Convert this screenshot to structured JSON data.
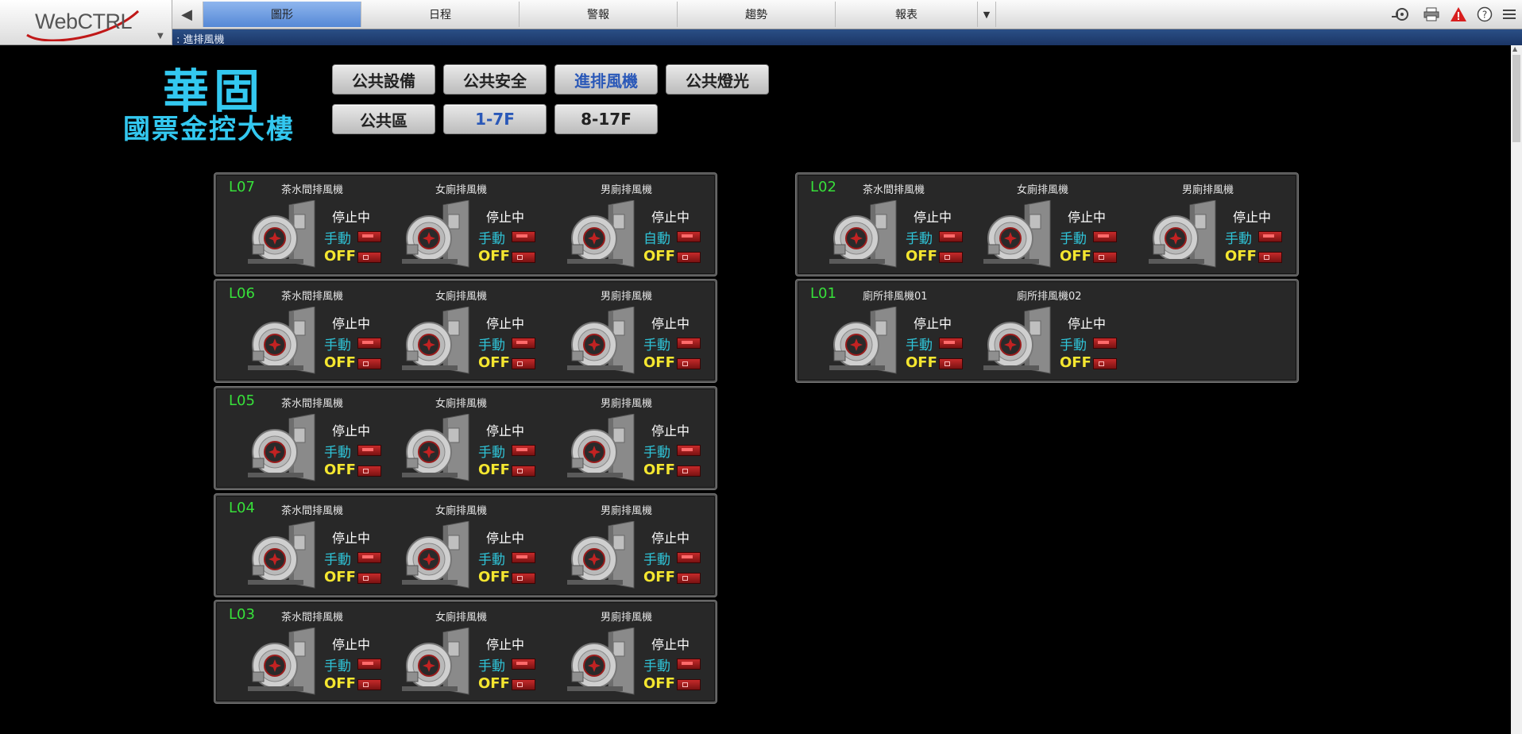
{
  "app": {
    "logo": "WebCTRL"
  },
  "nav": {
    "tabs": [
      {
        "label": "圖形",
        "active": true
      },
      {
        "label": "日程",
        "active": false
      },
      {
        "label": "警報",
        "active": false
      },
      {
        "label": "趨勢",
        "active": false
      },
      {
        "label": "報表",
        "active": false
      }
    ],
    "tools": [
      "network-icon",
      "print-icon",
      "alarm-warning-icon",
      "help-icon",
      "menu-icon"
    ]
  },
  "breadcrumb": ": 進排風機",
  "building": {
    "line1": "華固",
    "line2": "國票金控大樓"
  },
  "categories": {
    "row1": [
      {
        "label": "公共設備",
        "selected": false
      },
      {
        "label": "公共安全",
        "selected": false
      },
      {
        "label": "進排風機",
        "selected": true
      },
      {
        "label": "公共燈光",
        "selected": false
      }
    ],
    "row2": [
      {
        "label": "公共區",
        "selected": false
      },
      {
        "label": "1-7F",
        "selected": true
      },
      {
        "label": "8-17F",
        "selected": false
      }
    ]
  },
  "panels": {
    "L07": {
      "floor": "L07",
      "units": [
        {
          "name": "茶水間排風機",
          "run": "停止中",
          "mode": "手動",
          "onoff": "OFF"
        },
        {
          "name": "女廁排風機",
          "run": "停止中",
          "mode": "手動",
          "onoff": "OFF"
        },
        {
          "name": "男廁排風機",
          "run": "停止中",
          "mode": "自動",
          "onoff": "OFF"
        }
      ]
    },
    "L06": {
      "floor": "L06",
      "units": [
        {
          "name": "茶水間排風機",
          "run": "停止中",
          "mode": "手動",
          "onoff": "OFF"
        },
        {
          "name": "女廁排風機",
          "run": "停止中",
          "mode": "手動",
          "onoff": "OFF"
        },
        {
          "name": "男廁排風機",
          "run": "停止中",
          "mode": "手動",
          "onoff": "OFF"
        }
      ]
    },
    "L05": {
      "floor": "L05",
      "units": [
        {
          "name": "茶水間排風機",
          "run": "停止中",
          "mode": "手動",
          "onoff": "OFF"
        },
        {
          "name": "女廁排風機",
          "run": "停止中",
          "mode": "手動",
          "onoff": "OFF"
        },
        {
          "name": "男廁排風機",
          "run": "停止中",
          "mode": "手動",
          "onoff": "OFF"
        }
      ]
    },
    "L04": {
      "floor": "L04",
      "units": [
        {
          "name": "茶水間排風機",
          "run": "停止中",
          "mode": "手動",
          "onoff": "OFF"
        },
        {
          "name": "女廁排風機",
          "run": "停止中",
          "mode": "手動",
          "onoff": "OFF"
        },
        {
          "name": "男廁排風機",
          "run": "停止中",
          "mode": "手動",
          "onoff": "OFF"
        }
      ]
    },
    "L03": {
      "floor": "L03",
      "units": [
        {
          "name": "茶水間排風機",
          "run": "停止中",
          "mode": "手動",
          "onoff": "OFF"
        },
        {
          "name": "女廁排風機",
          "run": "停止中",
          "mode": "手動",
          "onoff": "OFF"
        },
        {
          "name": "男廁排風機",
          "run": "停止中",
          "mode": "手動",
          "onoff": "OFF"
        }
      ]
    },
    "L02": {
      "floor": "L02",
      "units": [
        {
          "name": "茶水間排風機",
          "run": "停止中",
          "mode": "手動",
          "onoff": "OFF"
        },
        {
          "name": "女廁排風機",
          "run": "停止中",
          "mode": "手動",
          "onoff": "OFF"
        },
        {
          "name": "男廁排風機",
          "run": "停止中",
          "mode": "手動",
          "onoff": "OFF"
        }
      ]
    },
    "L01": {
      "floor": "L01",
      "units": [
        {
          "name": "廁所排風機01",
          "run": "停止中",
          "mode": "手動",
          "onoff": "OFF"
        },
        {
          "name": "廁所排風機02",
          "run": "停止中",
          "mode": "手動",
          "onoff": "OFF"
        }
      ]
    }
  },
  "colors": {
    "floor_label": "#37e03a",
    "mode_text": "#2fc4d8",
    "onoff_text": "#f4e630",
    "nav_active": "#6b97de"
  }
}
